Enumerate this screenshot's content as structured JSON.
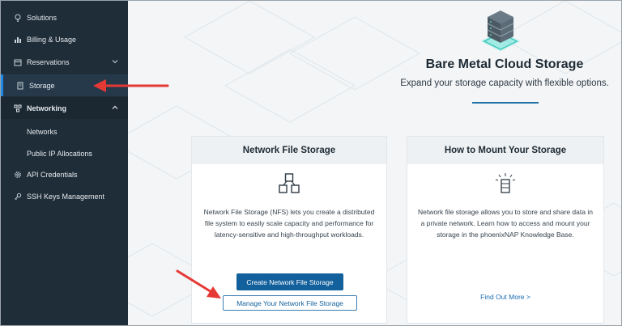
{
  "sidebar": {
    "items": [
      {
        "label": "Solutions",
        "icon": "bulb-icon"
      },
      {
        "label": "Billing & Usage",
        "icon": "bar-chart-icon"
      },
      {
        "label": "Reservations",
        "icon": "calendar-icon"
      },
      {
        "label": "Storage",
        "icon": "storage-icon"
      },
      {
        "label": "Networking",
        "icon": "network-icon"
      },
      {
        "label": "Networks"
      },
      {
        "label": "Public IP Allocations"
      },
      {
        "label": "API Credentials",
        "icon": "gear-icon"
      },
      {
        "label": "SSH Keys Management",
        "icon": "key-icon"
      }
    ]
  },
  "hero": {
    "title": "Bare Metal Cloud Storage",
    "subtitle": "Expand your storage capacity with flexible options."
  },
  "cards": {
    "nfs": {
      "title": "Network File Storage",
      "description": "Network File Storage (NFS) lets you create a distributed file system to easily scale capacity and performance for latency-sensitive and high-throughput workloads.",
      "primary_button": "Create Network File Storage",
      "secondary_button": "Manage Your Network File Storage"
    },
    "mount": {
      "title": "How to Mount Your Storage",
      "description": "Network file storage allows you to store and share data in a private network. Learn how to access and mount your storage in the phoenixNAP Knowledge Base.",
      "link": "Find Out More >"
    }
  },
  "colors": {
    "sidebar_bg": "#1f2d38",
    "active_accent": "#1e88e5",
    "primary": "#12609c",
    "annotation_arrow": "#e53935"
  }
}
